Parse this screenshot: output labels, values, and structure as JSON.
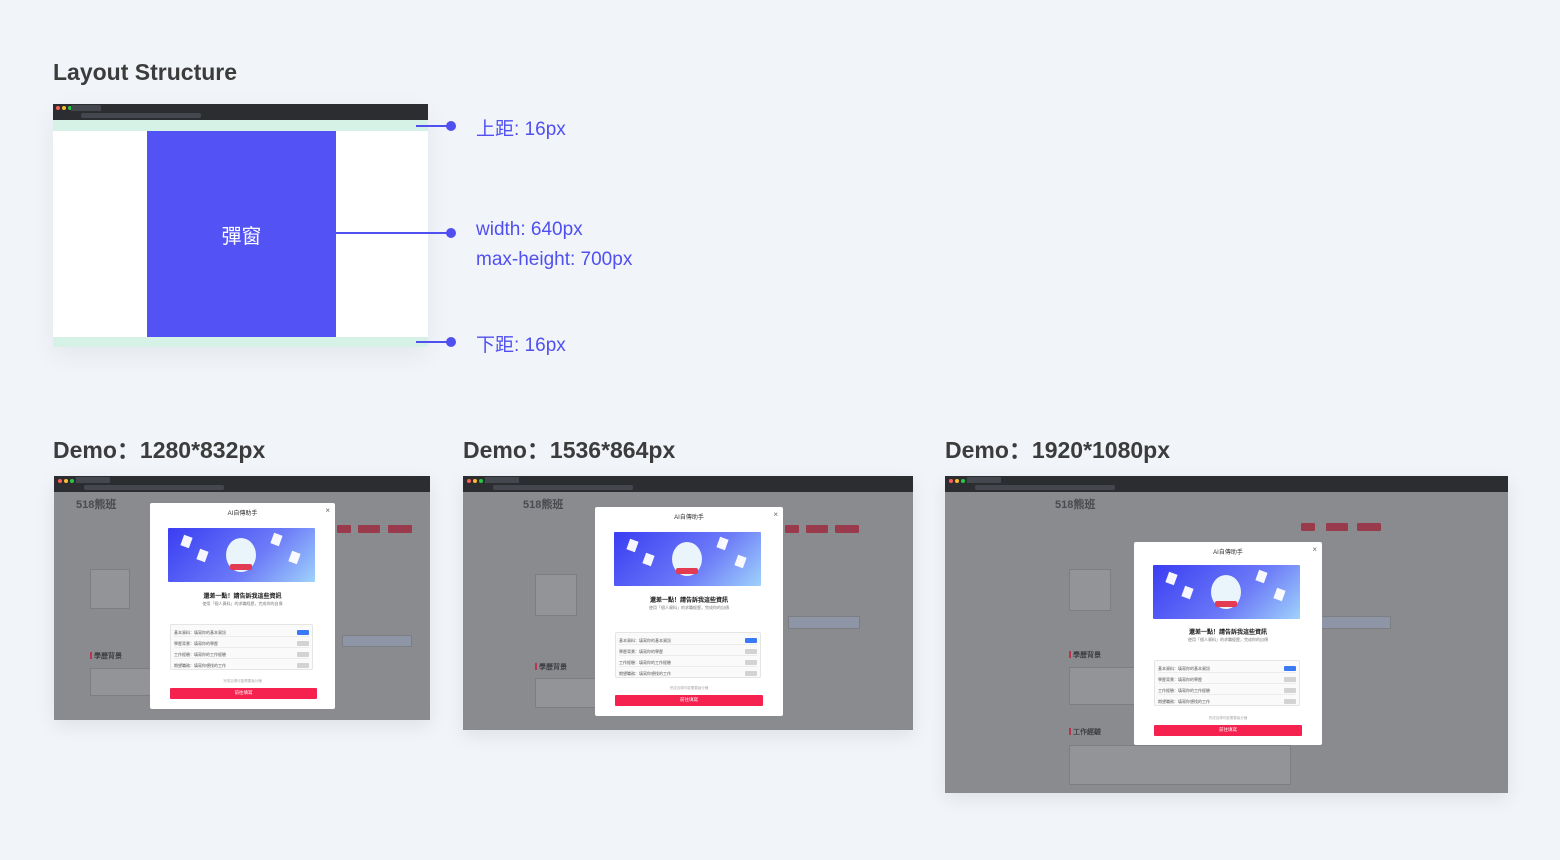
{
  "layout_section": {
    "title": "Layout Structure",
    "modal_label": "彈窗",
    "annotations": {
      "top_margin": "上距: 16px",
      "width": "width: 640px",
      "max_height": "max-height: 700px",
      "bottom_margin": "下距: 16px"
    }
  },
  "demos": [
    {
      "title": "Demo：1280*832px"
    },
    {
      "title": "Demo：1536*864px"
    },
    {
      "title": "Demo：1920*1080px"
    }
  ],
  "demo_site": {
    "logo": "518熊班",
    "modal_title": "AI自傳助手",
    "close": "×",
    "heading": "還差一點！請告訴我這些資訊",
    "desc": "使用「個人資料」的求職經歷，完成你的自傳",
    "rows": [
      "基本資料：填寫你的基本資訊",
      "學歷背景：填寫你的學歷",
      "工作經驗：填寫你的工作經驗",
      "期望職務：填寫你想找的工作"
    ],
    "footer": "完成自傳可能需要幾分鐘",
    "button": "前往填寫",
    "section_1": "學歷背景",
    "section_2": "工作經驗"
  },
  "colors": {
    "accent": "#5050f0",
    "modal_fill": "#5252f5",
    "margin_band": "#d6f1e6",
    "primary_button": "#f5224f"
  }
}
